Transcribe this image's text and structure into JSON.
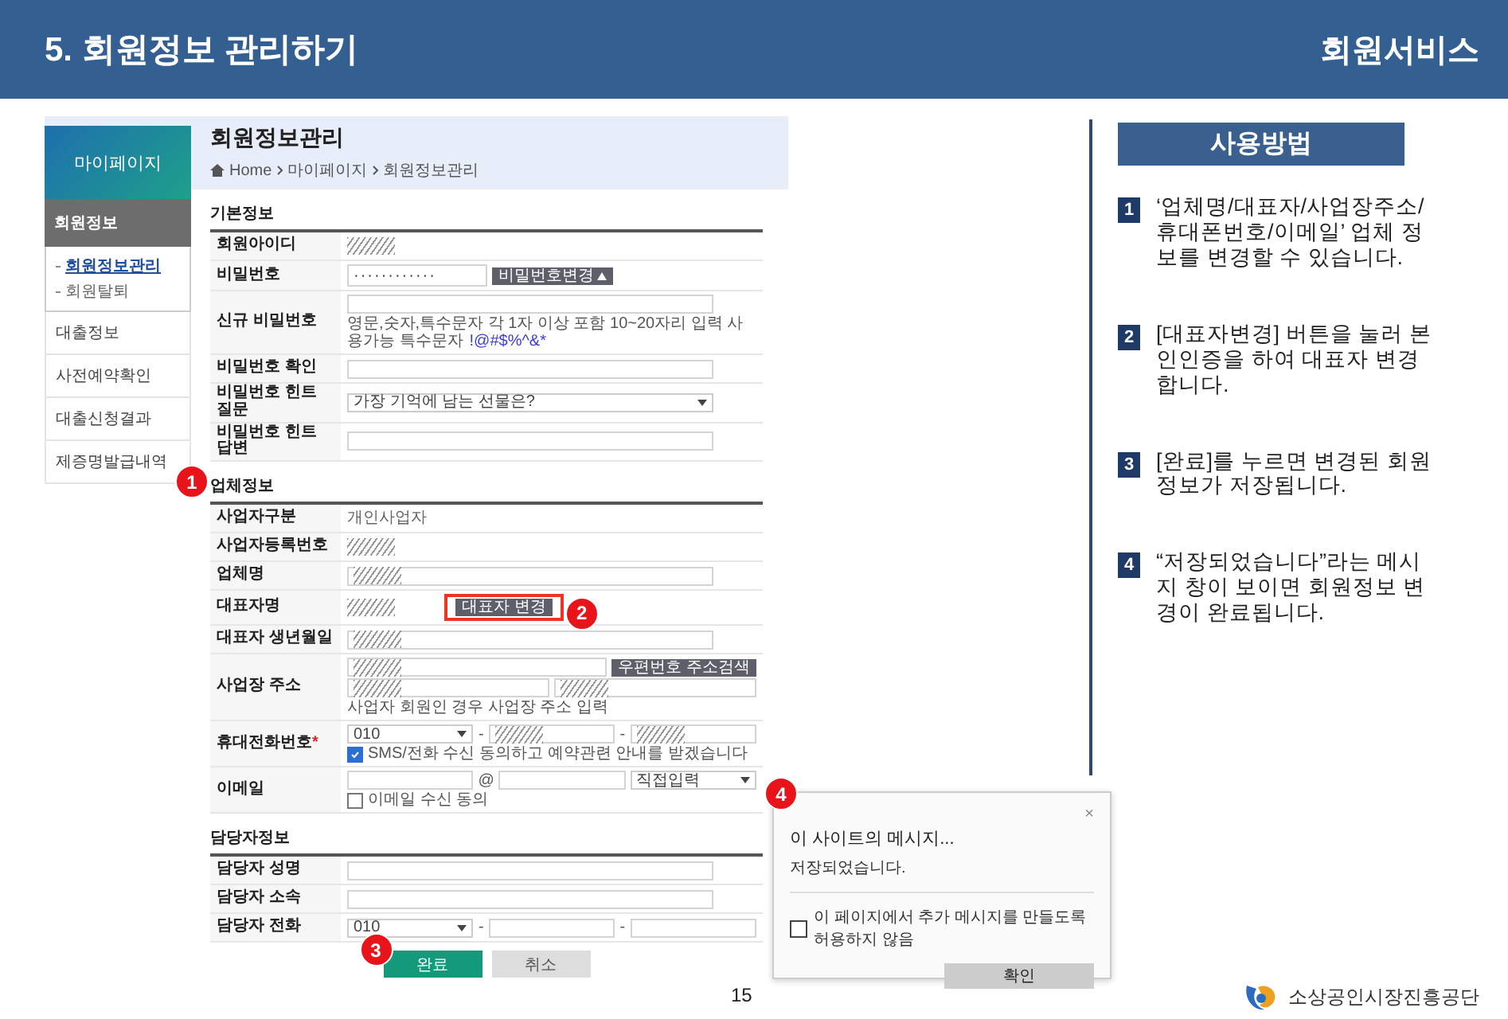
{
  "header": {
    "title": "5. 회원정보 관리하기",
    "section": "회원서비스"
  },
  "screenshot": {
    "sidebar": {
      "title": "마이페이지",
      "group": "회원정보",
      "subitems": [
        {
          "label": "회원정보관리",
          "selected": true
        },
        {
          "label": "회원탈퇴",
          "selected": false
        }
      ],
      "items": [
        "대출정보",
        "사전예약확인",
        "대출신청결과",
        "제증명발급내역"
      ]
    },
    "banner": {
      "title": "회원정보관리",
      "breadcrumb": [
        "Home",
        "마이페이지",
        "회원정보관리"
      ]
    },
    "sections": [
      {
        "title": "기본정보",
        "rows": [
          {
            "label": "회원아이디",
            "lines": [
              [
                {
                  "kind": "masked"
                }
              ]
            ]
          },
          {
            "label": "비밀번호",
            "lines": [
              [
                {
                  "kind": "password",
                  "value": "············"
                },
                {
                  "kind": "expand-button",
                  "label": "비밀번호변경"
                }
              ]
            ]
          },
          {
            "label": "신규 비밀번호",
            "lines": [
              [
                {
                  "kind": "input"
                }
              ],
              [
                {
                  "kind": "hint",
                  "text": "영문,숫자,특수문자 각 1자 이상 포함 10~20자리 입력  사용가능 특수문자",
                  "accent": "!@#$%^&*"
                }
              ]
            ]
          },
          {
            "label": "비밀번호 확인",
            "lines": [
              [
                {
                  "kind": "input"
                }
              ]
            ]
          },
          {
            "label": "비밀번호 힌트 질문",
            "lines": [
              [
                {
                  "kind": "select",
                  "value": "가장 기억에 남는 선물은?"
                }
              ]
            ]
          },
          {
            "label": "비밀번호 힌트 답변",
            "lines": [
              [
                {
                  "kind": "input"
                }
              ]
            ]
          }
        ]
      },
      {
        "title": "업체정보",
        "callout": "1",
        "rows": [
          {
            "label": "사업자구분",
            "lines": [
              [
                {
                  "kind": "text",
                  "value": "개인사업자"
                }
              ]
            ]
          },
          {
            "label": "사업자등록번호",
            "lines": [
              [
                {
                  "kind": "masked"
                }
              ]
            ]
          },
          {
            "label": "업체명",
            "lines": [
              [
                {
                  "kind": "masked-field"
                }
              ]
            ]
          },
          {
            "label": "대표자명",
            "lines": [
              [
                {
                  "kind": "masked"
                },
                {
                  "kind": "button",
                  "label": "대표자 변경",
                  "callout": "2"
                }
              ]
            ]
          },
          {
            "label": "대표자 생년월일",
            "lines": [
              [
                {
                  "kind": "masked-field"
                }
              ]
            ]
          },
          {
            "label": "사업장 주소",
            "lines": [
              [
                {
                  "kind": "masked-field"
                },
                {
                  "kind": "button",
                  "label": "우편번호 주소검색"
                }
              ],
              [
                {
                  "kind": "masked-field"
                },
                {
                  "kind": "masked-field"
                }
              ],
              [
                {
                  "kind": "hint",
                  "text": "사업자 회원인 경우 사업장 주소 입력"
                }
              ]
            ]
          },
          {
            "label": "휴대전화번호",
            "required_mark": "*",
            "lines": [
              [
                {
                  "kind": "select",
                  "value": "010"
                },
                {
                  "kind": "sep",
                  "text": "-"
                },
                {
                  "kind": "masked-field"
                },
                {
                  "kind": "sep",
                  "text": "-"
                },
                {
                  "kind": "masked-field"
                }
              ],
              [
                {
                  "kind": "checkbox",
                  "label": "SMS/전화 수신 동의하고 예약관련 안내를 받겠습니다",
                  "checked": true
                }
              ]
            ]
          },
          {
            "label": "이메일",
            "lines": [
              [
                {
                  "kind": "input"
                },
                {
                  "kind": "sep",
                  "text": "@"
                },
                {
                  "kind": "input"
                },
                {
                  "kind": "select",
                  "value": "직접입력"
                }
              ],
              [
                {
                  "kind": "checkbox",
                  "label": "이메일 수신 동의",
                  "checked": false
                }
              ]
            ]
          }
        ]
      },
      {
        "title": "담당자정보",
        "rows": [
          {
            "label": "담당자 성명",
            "lines": [
              [
                {
                  "kind": "input"
                }
              ]
            ]
          },
          {
            "label": "담당자 소속",
            "lines": [
              [
                {
                  "kind": "input"
                }
              ]
            ]
          },
          {
            "label": "담당자 전화",
            "lines": [
              [
                {
                  "kind": "select",
                  "value": "010"
                },
                {
                  "kind": "sep",
                  "text": "-"
                },
                {
                  "kind": "input"
                },
                {
                  "kind": "sep",
                  "text": "-"
                },
                {
                  "kind": "input"
                }
              ]
            ]
          }
        ]
      }
    ],
    "buttons": [
      {
        "label": "완료",
        "kind": "primary",
        "callout": "3"
      },
      {
        "label": "취소",
        "kind": "secondary"
      }
    ]
  },
  "instructions": {
    "title": "사용방법",
    "steps": [
      {
        "number": "1",
        "text": "‘업체명/대표자/사업장주소/휴대폰번호/이메일’ 업체 정보를 변경할 수 있습니다."
      },
      {
        "number": "2",
        "text": "[대표자변경] 버튼을 눌러 본인인증을 하여 대표자 변경합니다."
      },
      {
        "number": "3",
        "text": "[완료]를 누르면 변경된 회원정보가 저장됩니다."
      },
      {
        "number": "4",
        "text": "“저장되었습니다”라는 메시지 창이 보이면 회원정보 변경이 완료됩니다."
      }
    ]
  },
  "dialog": {
    "callout": "4",
    "close": "×",
    "title": "이 사이트의 메시지...",
    "message": "저장되었습니다.",
    "checkbox": {
      "label": "이 페이지에서 추가 메시지를 만들도록 허용하지 않음",
      "checked": false
    },
    "button": "확인"
  },
  "footer": {
    "page": "15",
    "organization": "소상공인시장진흥공단"
  }
}
